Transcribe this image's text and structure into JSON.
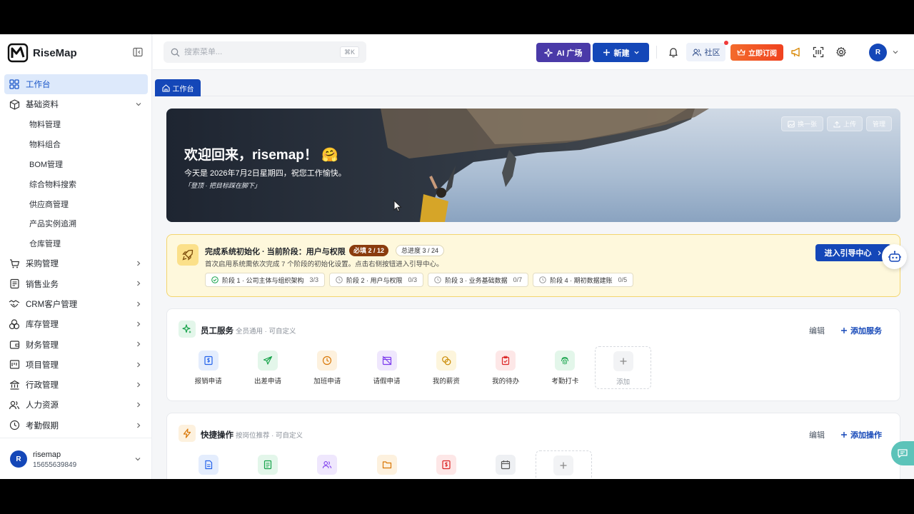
{
  "app": {
    "name": "RiseMap"
  },
  "sidebar": {
    "items": [
      {
        "label": "工作台",
        "icon": "dashboard-icon",
        "active": true
      },
      {
        "label": "基础资料",
        "icon": "cube-icon",
        "expanded": true,
        "children": [
          "物料管理",
          "物料组合",
          "BOM管理",
          "综合物料搜索",
          "供应商管理",
          "产品实例追溯",
          "仓库管理"
        ]
      },
      {
        "label": "采购管理",
        "icon": "cart-icon"
      },
      {
        "label": "销售业务",
        "icon": "receipt-icon"
      },
      {
        "label": "CRM客户管理",
        "icon": "handshake-icon"
      },
      {
        "label": "库存管理",
        "icon": "boxes-icon"
      },
      {
        "label": "财务管理",
        "icon": "wallet-icon"
      },
      {
        "label": "项目管理",
        "icon": "project-icon"
      },
      {
        "label": "行政管理",
        "icon": "bank-icon"
      },
      {
        "label": "人力资源",
        "icon": "users-icon"
      },
      {
        "label": "考勤假期",
        "icon": "clock-icon"
      }
    ],
    "user": {
      "avatar": "R",
      "name": "risemap",
      "phone": "15655639849"
    }
  },
  "header": {
    "search_placeholder": "搜索菜单...",
    "search_shortcut": "⌘K",
    "ai_label": "AI 广场",
    "new_label": "新建",
    "community_label": "社区",
    "subscribe_label": "立即订阅",
    "avatar": "R"
  },
  "tabs": [
    {
      "label": "工作台"
    }
  ],
  "banner": {
    "title": "欢迎回来，risemap！",
    "emoji": "🤗",
    "subtitle": "今天是 2026年7月2日星期四，祝您工作愉快。",
    "quote": "「登顶 · 把目标踩在脚下」",
    "buttons": [
      "换一张",
      "上传",
      "管理"
    ]
  },
  "onboarding": {
    "title": "完成系统初始化 · 当前阶段：用户与权限",
    "required_badge": "必填 2 / 12",
    "total_badge": "总进度 3 / 24",
    "description": "首次启用系统需依次完成 7 个阶段的初始化设置。点击右侧按钮进入引导中心。",
    "button": "进入引导中心",
    "stages": [
      {
        "label": "阶段 1 · 公司主体与组织架构",
        "count": "3/3",
        "done": true
      },
      {
        "label": "阶段 2 · 用户与权限",
        "count": "0/3",
        "done": false
      },
      {
        "label": "阶段 3 · 业务基础数据",
        "count": "0/7",
        "done": false
      },
      {
        "label": "阶段 4 · 期初数据建账",
        "count": "0/5",
        "done": false
      }
    ]
  },
  "employee_services": {
    "title": "员工服务",
    "subtitle": "全员通用 · 可自定义",
    "edit": "编辑",
    "add": "添加服务",
    "items": [
      {
        "label": "报销申请",
        "icon": "reimburse-icon",
        "color": "#2563eb",
        "bg": "#e4edfd"
      },
      {
        "label": "出差申请",
        "icon": "plane-icon",
        "color": "#16a34a",
        "bg": "#e3f6ea"
      },
      {
        "label": "加班申请",
        "icon": "clock-icon",
        "color": "#d97706",
        "bg": "#fdf1de"
      },
      {
        "label": "请假申请",
        "icon": "calendar-off-icon",
        "color": "#7c3aed",
        "bg": "#efe7fd"
      },
      {
        "label": "我的薪资",
        "icon": "coins-icon",
        "color": "#ca8a04",
        "bg": "#fdf5dc"
      },
      {
        "label": "我的待办",
        "icon": "clipboard-check-icon",
        "color": "#dc2626",
        "bg": "#fde7e7"
      },
      {
        "label": "考勤打卡",
        "icon": "fingerprint-icon",
        "color": "#16a34a",
        "bg": "#e3f6ea"
      }
    ],
    "add_tile": "添加"
  },
  "quick_actions": {
    "title": "快捷操作",
    "subtitle": "按岗位推荐 · 可自定义",
    "edit": "编辑",
    "add": "添加操作"
  }
}
